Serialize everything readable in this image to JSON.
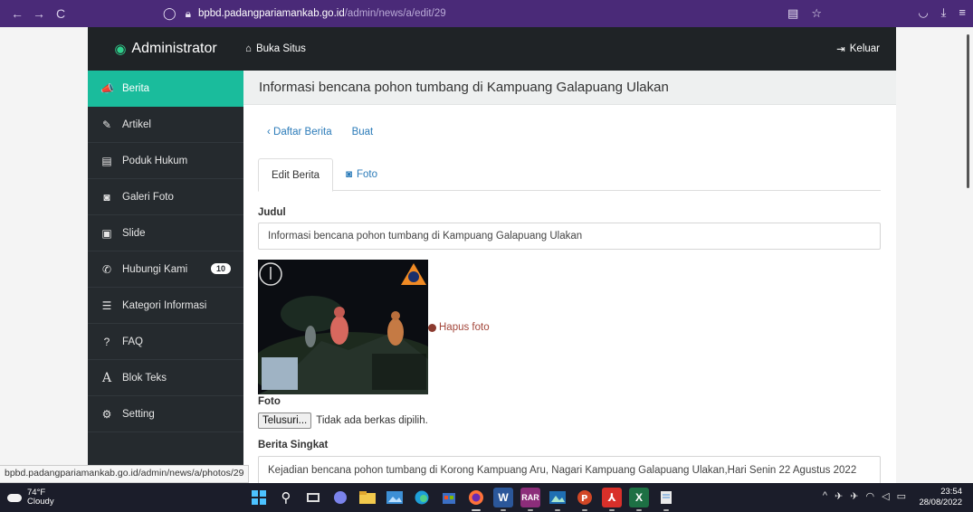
{
  "browser": {
    "back": "←",
    "forward": "→",
    "reload": "C",
    "url_host": "bpbd.padangpariamankab.go.id",
    "url_path": "/admin/news/a/edit/29"
  },
  "app": {
    "brand": "Administrator",
    "site_link": "Buka Situs",
    "logout": "Keluar"
  },
  "sidebar": {
    "items": [
      {
        "label": "Berita",
        "icon": "megaphone-icon",
        "glyph": "📣"
      },
      {
        "label": "Artikel",
        "icon": "pencil-icon",
        "glyph": "✎"
      },
      {
        "label": "Poduk Hukum",
        "icon": "save-icon",
        "glyph": "▤"
      },
      {
        "label": "Galeri Foto",
        "icon": "camera-icon",
        "glyph": "◙"
      },
      {
        "label": "Slide",
        "icon": "image-icon",
        "glyph": "▣"
      },
      {
        "label": "Hubungi Kami",
        "icon": "phone-icon",
        "glyph": "✆",
        "badge": "10"
      },
      {
        "label": "Kategori Informasi",
        "icon": "list-icon",
        "glyph": "☰"
      },
      {
        "label": "FAQ",
        "icon": "question-icon",
        "glyph": "?"
      },
      {
        "label": "Blok Teks",
        "icon": "font-icon",
        "glyph": "A"
      },
      {
        "label": "Setting",
        "icon": "gear-icon",
        "glyph": "⚙"
      }
    ]
  },
  "content": {
    "title": "Informasi bencana pohon tumbang di Kampuang Galapuang Ulakan",
    "crumb_list": "Daftar Berita",
    "crumb_create": "Buat",
    "tab_edit": "Edit Berita",
    "tab_photo": "Foto",
    "label_title": "Judul",
    "title_value": "Informasi bencana pohon tumbang di  Kampuang Galapuang Ulakan",
    "delete_photo": "Hapus foto",
    "label_photo": "Foto",
    "browse_button": "Telusuri...",
    "no_file": "Tidak ada berkas dipilih.",
    "label_summary": "Berita Singkat",
    "summary_value": "Kejadian bencana pohon tumbang di Korong Kampuang Aru, Nagari Kampuang Galapuang Ulakan,Hari Senin 22 Agustus 2022"
  },
  "status_tip": "bpbd.padangpariamankab.go.id/admin/news/a/photos/29",
  "taskbar": {
    "temperature": "74°F",
    "weather": "Cloudy",
    "time": "23:54",
    "date": "28/08/2022"
  }
}
